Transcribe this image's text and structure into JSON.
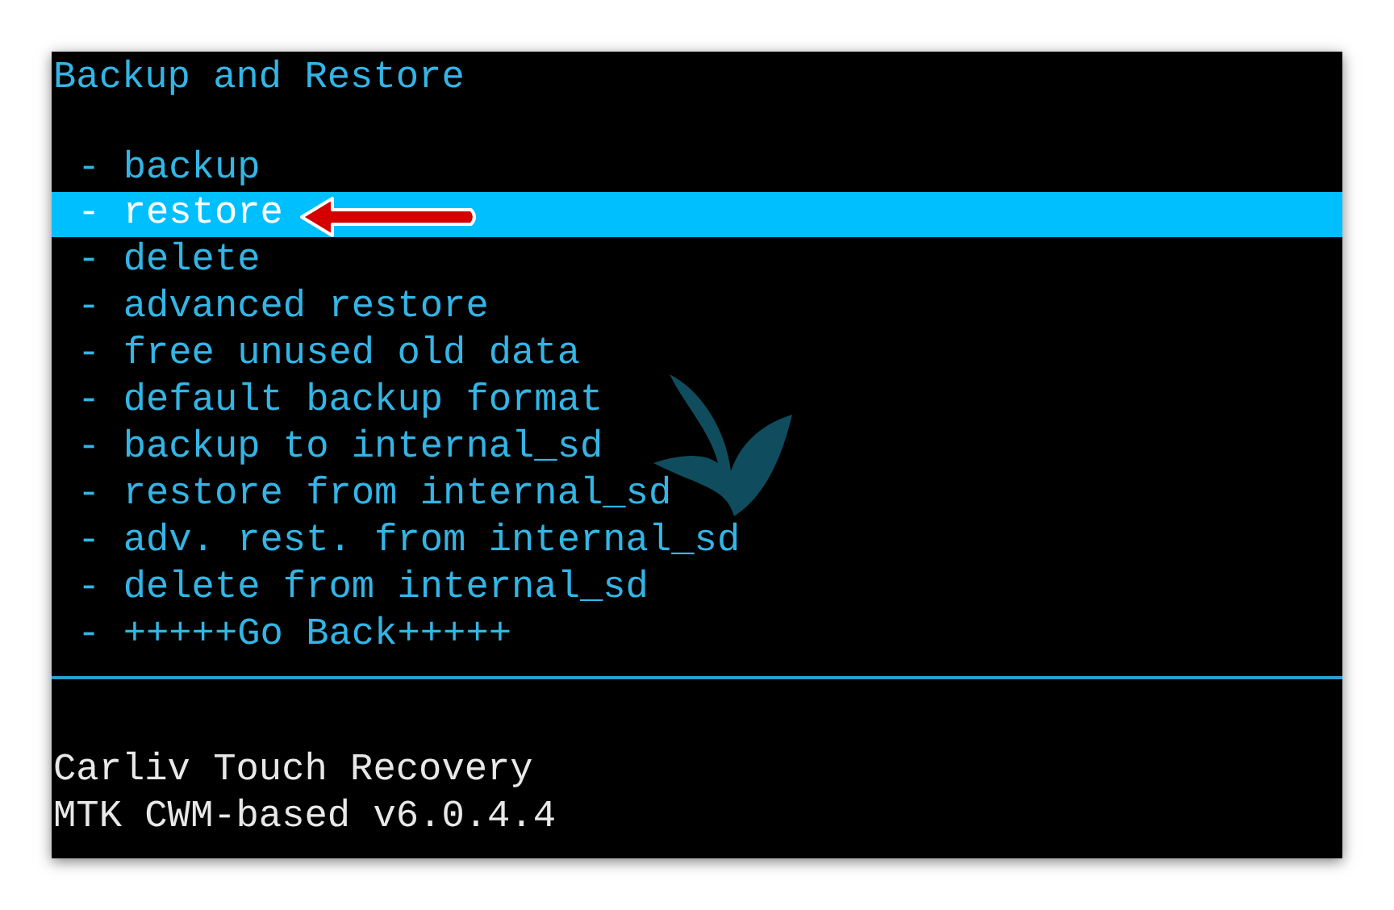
{
  "title": "Backup and Restore",
  "menu": [
    {
      "label": "- backup",
      "selected": false
    },
    {
      "label": "- restore",
      "selected": true
    },
    {
      "label": "- delete",
      "selected": false
    },
    {
      "label": "- advanced restore",
      "selected": false
    },
    {
      "label": "- free unused old data",
      "selected": false
    },
    {
      "label": "- default backup format",
      "selected": false
    },
    {
      "label": "- backup to internal_sd",
      "selected": false
    },
    {
      "label": "- restore from internal_sd",
      "selected": false
    },
    {
      "label": "- adv. rest. from internal_sd",
      "selected": false
    },
    {
      "label": "- delete from internal_sd",
      "selected": false
    },
    {
      "label": "- +++++Go Back+++++",
      "selected": false
    }
  ],
  "footer": [
    "Carliv Touch Recovery",
    "MTK CWM-based v6.0.4.4"
  ]
}
